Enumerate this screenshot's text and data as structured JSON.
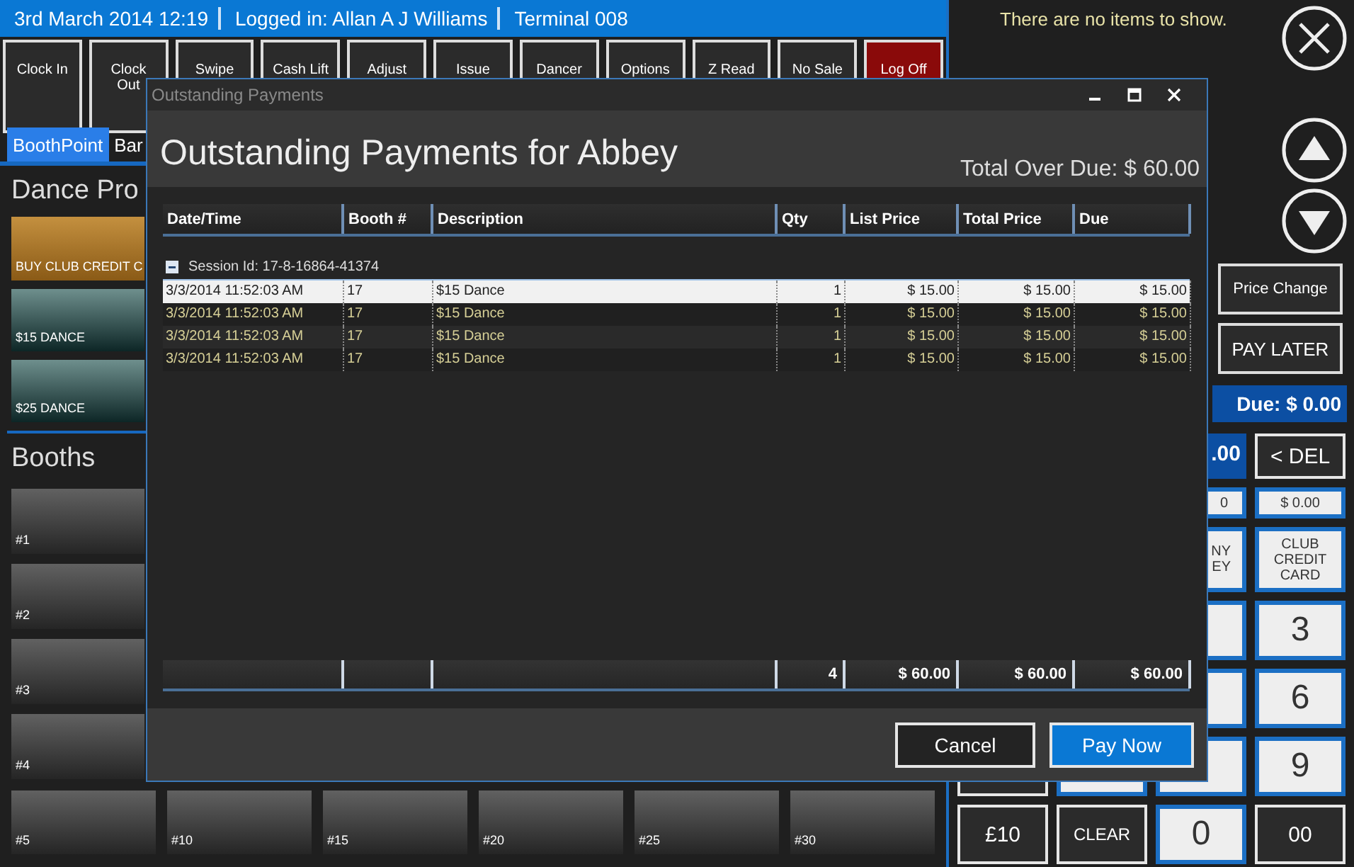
{
  "status_bar": {
    "date_time": "3rd March 2014 12:19",
    "user": "Logged in: Allan A J Williams",
    "terminal": "Terminal 008"
  },
  "toolbar": [
    {
      "lines": [
        "Clock In"
      ],
      "kind": "normal"
    },
    {
      "lines": [
        "Clock",
        "Out"
      ],
      "kind": "normal"
    },
    {
      "lines": [
        "Swipe"
      ],
      "kind": "normal"
    },
    {
      "lines": [
        "Cash Lift"
      ],
      "kind": "normal"
    },
    {
      "lines": [
        "Adjust"
      ],
      "kind": "normal"
    },
    {
      "lines": [
        "Issue"
      ],
      "kind": "normal"
    },
    {
      "lines": [
        "Dancer"
      ],
      "kind": "normal"
    },
    {
      "lines": [
        "Options"
      ],
      "kind": "normal"
    },
    {
      "lines": [
        "Z Read"
      ],
      "kind": "normal"
    },
    {
      "lines": [
        "No Sale"
      ],
      "kind": "normal"
    },
    {
      "lines": [
        "Log Off"
      ],
      "kind": "danger"
    }
  ],
  "tabs": [
    {
      "label": "BoothPoint",
      "selected": true
    },
    {
      "label": "Bar",
      "selected": false
    }
  ],
  "products": {
    "title": "Dance Pro",
    "items": [
      {
        "label": "BUY CLUB CREDIT C",
        "kind": "gold"
      },
      {
        "label": "$15 DANCE",
        "kind": "teal"
      },
      {
        "label": "$25 DANCE",
        "kind": "teal"
      }
    ]
  },
  "booths": {
    "title": "Booths",
    "items": [
      "#1",
      "#2",
      "#3",
      "#4",
      "#5",
      "#10",
      "#15",
      "#20",
      "#25",
      "#30"
    ]
  },
  "sale_panel": {
    "empty_message": "There are no items to show.",
    "actions": [
      "Price Change",
      "PAY LATER"
    ],
    "due": "Due: $ 0.00",
    "tendered": ".00",
    "delete_key": "< DEL",
    "amount_fields": [
      "0",
      "$ 0.00"
    ],
    "payment_keys": [
      {
        "lines": [
          "NY",
          "EY"
        ]
      },
      {
        "lines": [
          "CLUB",
          "CREDIT",
          "CARD"
        ]
      }
    ],
    "digit_keys": [
      "3",
      "6",
      "9"
    ],
    "bottom_keys": [
      {
        "label": "£10",
        "kind": "dark"
      },
      {
        "label": "CLEAR",
        "kind": "dark"
      },
      {
        "label": "0",
        "kind": "light"
      },
      {
        "label": "00",
        "kind": "dark"
      }
    ]
  },
  "dialog": {
    "window_title": "Outstanding Payments",
    "title": "Outstanding Payments for Abbey",
    "total_overdue": "Total Over Due: $ 60.00",
    "table": {
      "columns": [
        {
          "label": "Date/Time"
        },
        {
          "label": "Booth #"
        },
        {
          "label": "Description"
        },
        {
          "label": "Qty",
          "total": "4"
        },
        {
          "label": "List Price",
          "total": "$ 60.00"
        },
        {
          "label": "Total Price",
          "total": "$ 60.00"
        },
        {
          "label": "Due",
          "total": "$ 60.00"
        }
      ],
      "groups": [
        {
          "label": "Session Id: 17-8-16864-41374",
          "expanded": true,
          "rows": [
            {
              "selected": true,
              "cells": [
                "3/3/2014 11:52:03 AM",
                "17",
                "$15 Dance",
                "1",
                "$ 15.00",
                "$ 15.00",
                "$ 15.00"
              ]
            },
            {
              "selected": false,
              "cells": [
                "3/3/2014 11:52:03 AM",
                "17",
                "$15 Dance",
                "1",
                "$ 15.00",
                "$ 15.00",
                "$ 15.00"
              ]
            },
            {
              "selected": false,
              "cells": [
                "3/3/2014 11:52:03 AM",
                "17",
                "$15 Dance",
                "1",
                "$ 15.00",
                "$ 15.00",
                "$ 15.00"
              ]
            },
            {
              "selected": false,
              "cells": [
                "3/3/2014 11:52:03 AM",
                "17",
                "$15 Dance",
                "1",
                "$ 15.00",
                "$ 15.00",
                "$ 15.00"
              ]
            }
          ]
        }
      ]
    },
    "buttons": [
      {
        "label": "Cancel",
        "kind": "secondary"
      },
      {
        "label": "Pay Now",
        "kind": "primary"
      }
    ]
  }
}
